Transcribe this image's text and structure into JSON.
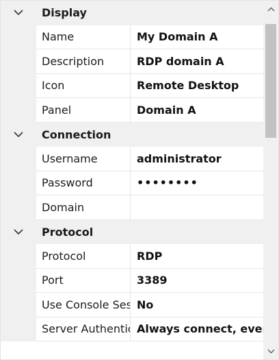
{
  "categories": [
    {
      "label": "Display",
      "properties": [
        {
          "name": "Name",
          "value": "My Domain A"
        },
        {
          "name": "Description",
          "value": "RDP domain A"
        },
        {
          "name": "Icon",
          "value": "Remote Desktop"
        },
        {
          "name": "Panel",
          "value": "Domain A"
        }
      ]
    },
    {
      "label": "Connection",
      "properties": [
        {
          "name": "Username",
          "value": "administrator"
        },
        {
          "name": "Password",
          "value": "••••••••"
        },
        {
          "name": "Domain",
          "value": ""
        }
      ]
    },
    {
      "label": "Protocol",
      "properties": [
        {
          "name": "Protocol",
          "value": "RDP"
        },
        {
          "name": "Port",
          "value": "3389"
        },
        {
          "name": "Use Console Session",
          "value": "No"
        },
        {
          "name": "Server Authentication",
          "value": "Always connect, even if authentication fails"
        }
      ]
    }
  ],
  "icons": {
    "category_toggle": "chevron-down-icon",
    "scroll_up": "chevron-up-icon",
    "scroll_down": "chevron-down-icon"
  },
  "colors": {
    "category_background": "#f0f0f0",
    "scrollbar_thumb": "#c2c2c2"
  }
}
